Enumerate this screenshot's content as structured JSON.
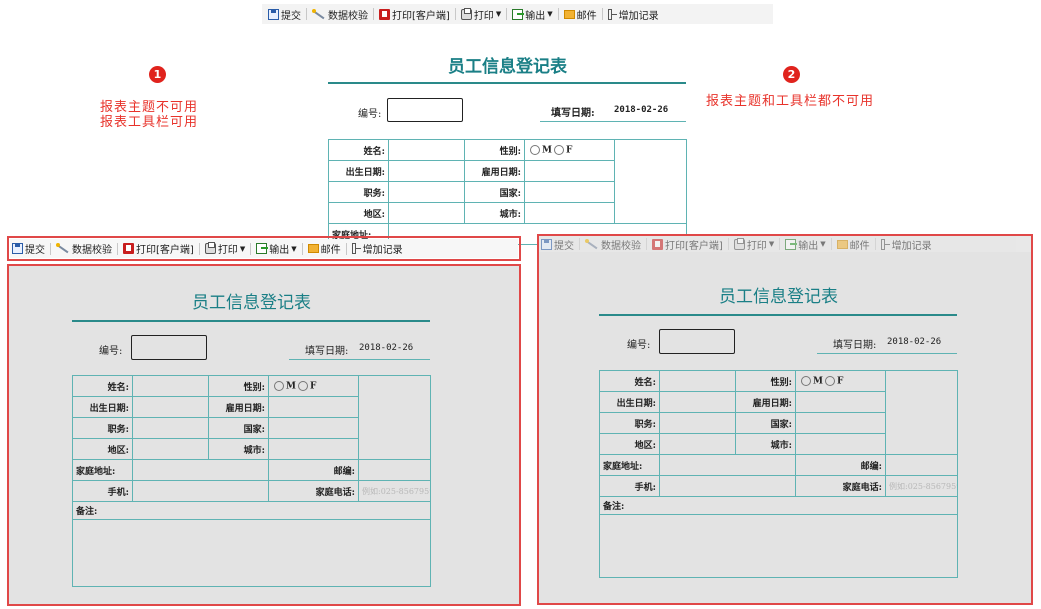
{
  "toolbar": {
    "submit": "提交",
    "validate": "数据校验",
    "print_client": "打印[客户端]",
    "print": "打印",
    "export": "输出",
    "mail": "邮件",
    "add_record": "增加记录"
  },
  "cases": [
    {
      "number": "1",
      "note_line1": "报表主题不可用",
      "note_line2": "报表工具栏可用"
    },
    {
      "number": "2",
      "note_line1": "报表主题和工具栏都不可用"
    }
  ],
  "form": {
    "title": "员工信息登记表",
    "id_label": "编号:",
    "date_label": "填写日期:",
    "date_value": "2018-02-26",
    "name": "姓名:",
    "gender": "性别:",
    "gender_m": "M",
    "gender_f": "F",
    "birth_date": "出生日期:",
    "hire_date": "雇用日期:",
    "position": "职务:",
    "country": "国家:",
    "region": "地区:",
    "city": "城市:",
    "address": "家庭地址:",
    "zip": "邮编:",
    "mobile": "手机:",
    "home_phone": "家庭电话:",
    "home_phone_placeholder": "例如:025-85679591",
    "remarks": "备注:"
  },
  "colors": {
    "accent": "#1a7f86",
    "highlight": "#e04848",
    "panel_bg": "#e3e3e3",
    "grid": "#5fb3b3"
  }
}
